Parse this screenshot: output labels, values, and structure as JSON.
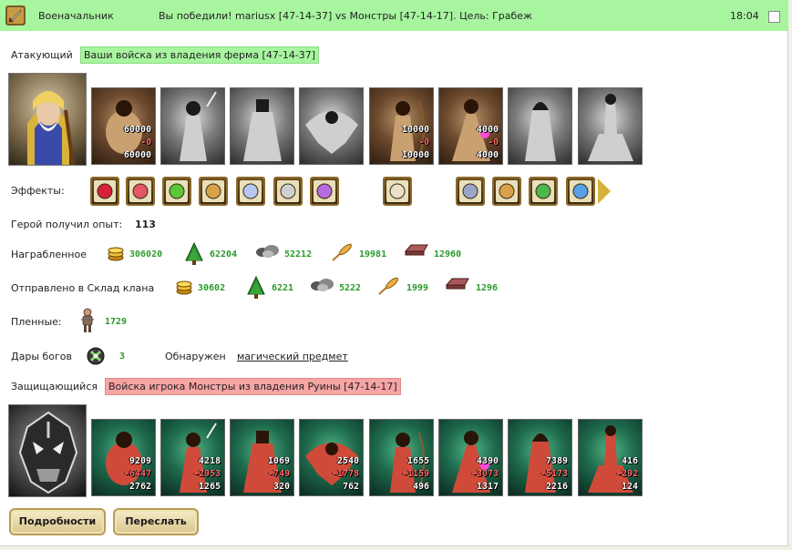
{
  "header": {
    "role": "Военачальник",
    "message": "Вы победили! mariusx [47-14-37] vs Монстры [47-14-17]. Цель: Грабеж",
    "time": "18:04"
  },
  "attacker": {
    "label": "Атакующий",
    "name": "Ваши войска из владения ферма [47-14-37]",
    "units": [
      {
        "name": "troll-unit",
        "style": "att",
        "count": "60000",
        "loss": "-0",
        "remaining": "60000"
      },
      {
        "name": "shadow-swordsman-unit",
        "style": "gray"
      },
      {
        "name": "armored-knight-unit",
        "style": "gray"
      },
      {
        "name": "griffin-unit",
        "style": "gray"
      },
      {
        "name": "archer-unit",
        "style": "att",
        "count": "10000",
        "loss": "-0",
        "remaining": "10000"
      },
      {
        "name": "sorceress-unit",
        "style": "att",
        "count": "4000",
        "loss": "-0",
        "remaining": "4000"
      },
      {
        "name": "hooded-assassin-unit",
        "style": "gray"
      },
      {
        "name": "dark-centaur-unit",
        "style": "gray"
      }
    ]
  },
  "effects": {
    "label": "Эффекты:",
    "items": [
      "heart-icon",
      "heart-shield-icon",
      "potion-icon",
      "totem-icon",
      "wing-icon",
      "amulet-icon",
      "claw-icon",
      "scroll-icon",
      "gate-icon",
      "pouch-icon",
      "handshake-shield-icon",
      "orb-icon"
    ]
  },
  "experience": {
    "label": "Герой получил опыт:",
    "value": "113"
  },
  "looted": {
    "label": "Награбленное",
    "gold": "306020",
    "wood": "62204",
    "ore": "52212",
    "grain": "19981",
    "iron": "12960"
  },
  "clan": {
    "label": "Отправлено в Склад клана",
    "gold": "30602",
    "wood": "6221",
    "ore": "5222",
    "grain": "1999",
    "iron": "1296"
  },
  "prisoners": {
    "label": "Пленные:",
    "value": "1729"
  },
  "gifts": {
    "label": "Дары богов",
    "value": "3",
    "found_label": "Обнаружен",
    "found_link": "магический предмет"
  },
  "defender": {
    "label": "Защищающийся",
    "name": "Войска игрока Монстры из владения Руины [47-14-17]",
    "units": [
      {
        "name": "lizard-warrior-unit",
        "count": "9209",
        "loss": "-6447",
        "remaining": "2762"
      },
      {
        "name": "ogre-brute-unit",
        "count": "4218",
        "loss": "-2953",
        "remaining": "1265"
      },
      {
        "name": "orc-warrior-unit",
        "count": "1069",
        "loss": "-749",
        "remaining": "320"
      },
      {
        "name": "red-demon-unit",
        "count": "2540",
        "loss": "-1778",
        "remaining": "762"
      },
      {
        "name": "spiked-beast-unit",
        "count": "1655",
        "loss": "-1159",
        "remaining": "496"
      },
      {
        "name": "fire-imp-unit",
        "count": "4390",
        "loss": "-3073",
        "remaining": "1317"
      },
      {
        "name": "winged-fiend-unit",
        "count": "7389",
        "loss": "-5173",
        "remaining": "2216"
      },
      {
        "name": "dark-mage-unit",
        "count": "416",
        "loss": "-292",
        "remaining": "124"
      }
    ]
  },
  "buttons": {
    "details": "Подробности",
    "forward": "Переслать"
  }
}
